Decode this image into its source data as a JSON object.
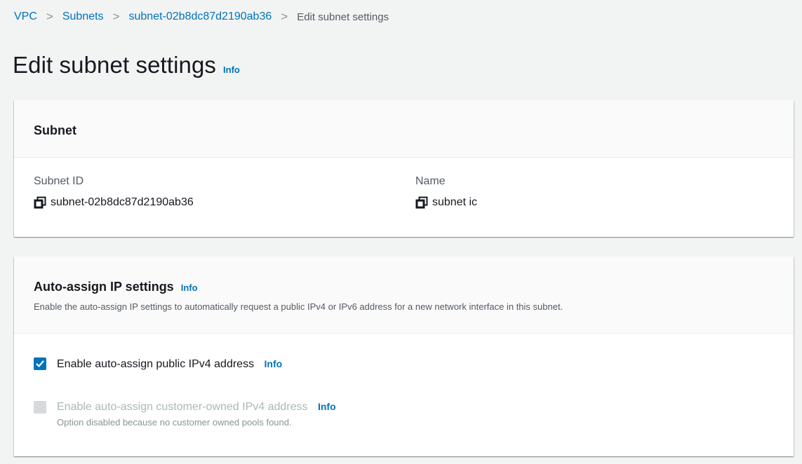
{
  "breadcrumb": {
    "items": [
      "VPC",
      "Subnets",
      "subnet-02b8dc87d2190ab36"
    ],
    "current": "Edit subnet settings"
  },
  "page": {
    "title": "Edit subnet settings",
    "info": "Info"
  },
  "subnet_card": {
    "title": "Subnet",
    "subnet_id_label": "Subnet ID",
    "subnet_id_value": "subnet-02b8dc87d2190ab36",
    "name_label": "Name",
    "name_value": "subnet ic"
  },
  "auto_assign_card": {
    "title": "Auto-assign IP settings",
    "info": "Info",
    "description": "Enable the auto-assign IP settings to automatically request a public IPv4 or IPv6 address for a new network interface in this subnet.",
    "options": [
      {
        "label": "Enable auto-assign public IPv4 address",
        "info": "Info",
        "checked": true,
        "disabled": false
      },
      {
        "label": "Enable auto-assign customer-owned IPv4 address",
        "info": "Info",
        "checked": false,
        "disabled": true,
        "description": "Option disabled because no customer owned pools found."
      }
    ]
  },
  "colors": {
    "link": "#0073bb",
    "checkbox_checked": "#0073bb",
    "checkbox_disabled": "#d5dbdb",
    "background": "#f2f3f3"
  },
  "icons": {
    "copy": "copy-icon",
    "check": "checkmark-icon",
    "separator": "chevron-right-icon"
  }
}
